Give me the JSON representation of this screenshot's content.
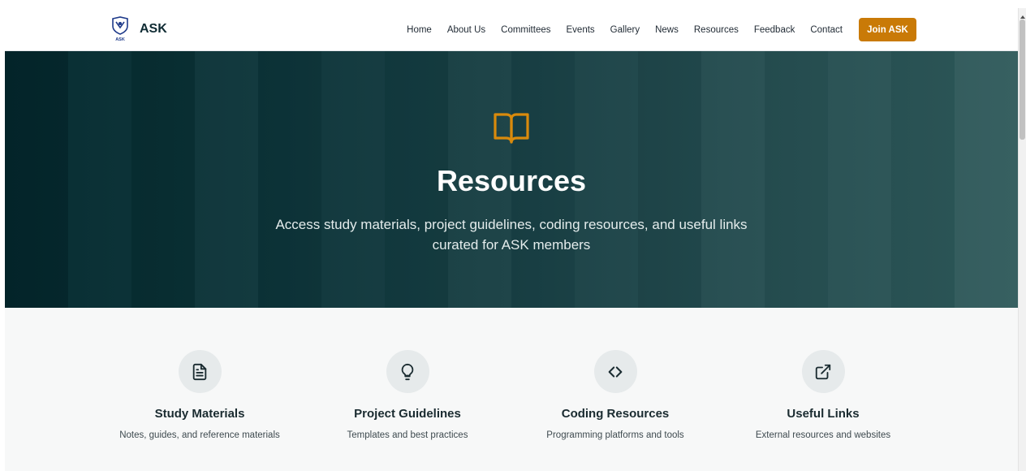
{
  "brand": {
    "name": "ASK",
    "logo_text": "ASK"
  },
  "nav": {
    "links": [
      "Home",
      "About Us",
      "Committees",
      "Events",
      "Gallery",
      "News",
      "Resources",
      "Feedback",
      "Contact"
    ],
    "cta": "Join ASK"
  },
  "hero": {
    "icon": "book-open-icon",
    "title": "Resources",
    "subtitle": "Access study materials, project guidelines, coding resources, and useful links curated for ASK members"
  },
  "categories": [
    {
      "icon": "file-text-icon",
      "title": "Study Materials",
      "desc": "Notes, guides, and reference materials"
    },
    {
      "icon": "lightbulb-icon",
      "title": "Project Guidelines",
      "desc": "Templates and best practices"
    },
    {
      "icon": "code-icon",
      "title": "Coding Resources",
      "desc": "Programming platforms and tools"
    },
    {
      "icon": "external-link-icon",
      "title": "Useful Links",
      "desc": "External resources and websites"
    }
  ],
  "colors": {
    "accent": "#c97a07",
    "hero_dark": "#04292e",
    "hero_light": "#2f5a5b",
    "text_dark": "#1a2b30"
  }
}
